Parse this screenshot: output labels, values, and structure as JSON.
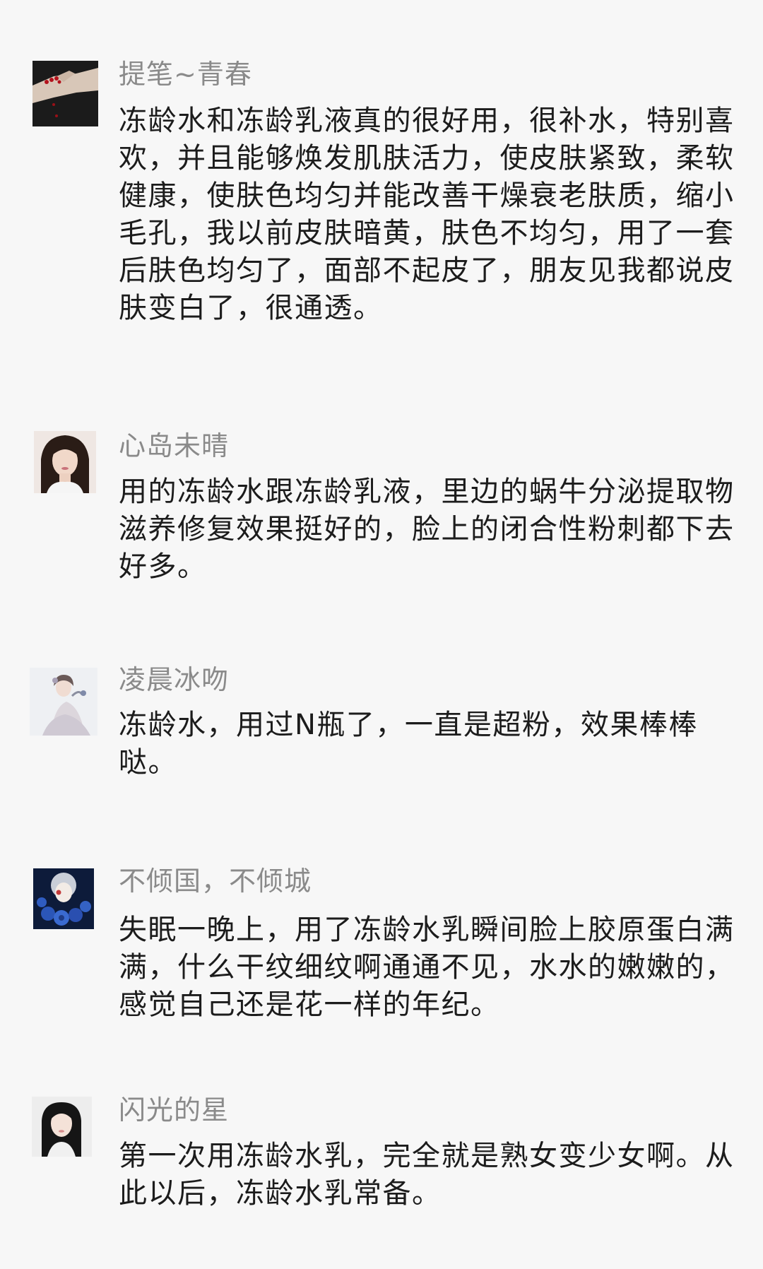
{
  "comments": [
    {
      "username": "提笔~青春",
      "text": "冻龄水和冻龄乳液真的很好用，很补水，特别喜欢，并且能够焕发肌肤活力，使皮肤紧致，柔软健康，使肤色均匀并能改善干燥衰老肤质，缩小毛孔，我以前皮肤暗黄，肤色不均匀，用了一套后肤色均匀了，面部不起皮了，朋友见我都说皮肤变白了，很通透。",
      "avatar_icon": "hand-with-red-nails-icon"
    },
    {
      "username": "心岛未晴",
      "text": "用的冻龄水跟冻龄乳液，里边的蜗牛分泌提取物滋养修复效果挺好的，脸上的闭合性粉刺都下去好多。",
      "avatar_icon": "woman-portrait-icon"
    },
    {
      "username": "凌晨冰吻",
      "text": "冻龄水，用过N瓶了，一直是超粉，效果棒棒哒。",
      "avatar_icon": "woman-in-white-dress-icon"
    },
    {
      "username": "不倾国，不倾城",
      "text": "失眠一晚上，用了冻龄水乳瞬间脸上胶原蛋白满满，什么干纹细纹啊通通不见，水水的嫩嫩的，感觉自己还是花一样的年纪。",
      "avatar_icon": "woman-with-blue-roses-icon"
    },
    {
      "username": "闪光的星",
      "text": "第一次用冻龄水乳，完全就是熟女变少女啊。从此以后，冻龄水乳常备。",
      "avatar_icon": "woman-selfie-icon"
    }
  ]
}
